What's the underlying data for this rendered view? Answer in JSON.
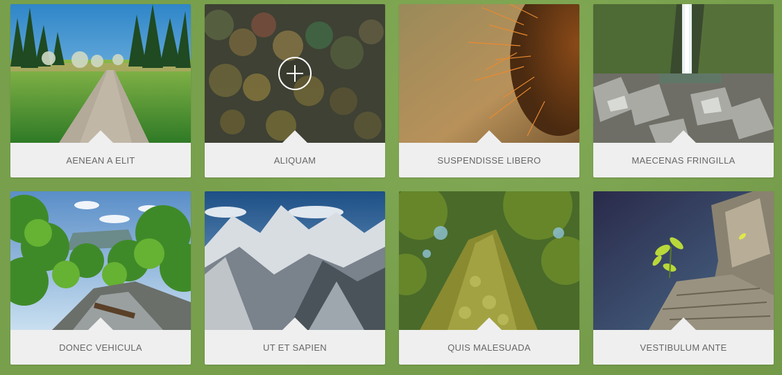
{
  "gallery": {
    "items": [
      {
        "caption": "AENEAN A ELIT",
        "image": "forest-path-photo"
      },
      {
        "caption": "ALIQUAM",
        "image": "bokeh-lights-photo",
        "overlay_icon": "plus-icon"
      },
      {
        "caption": "SUSPENDISSE LIBERO",
        "image": "cactus-spines-photo"
      },
      {
        "caption": "MAECENAS FRINGILLA",
        "image": "waterfall-rocks-photo"
      },
      {
        "caption": "DONEC VEHICULA",
        "image": "green-valley-stream-photo"
      },
      {
        "caption": "UT ET SAPIEN",
        "image": "snowy-mountains-photo"
      },
      {
        "caption": "QUIS MALESUADA",
        "image": "mossy-tree-trunk-photo"
      },
      {
        "caption": "VESTIBULUM ANTE",
        "image": "sprout-on-wood-photo"
      }
    ]
  },
  "colors": {
    "background": "#78a04c",
    "caption_bg": "#efefef",
    "caption_text": "#666666"
  }
}
